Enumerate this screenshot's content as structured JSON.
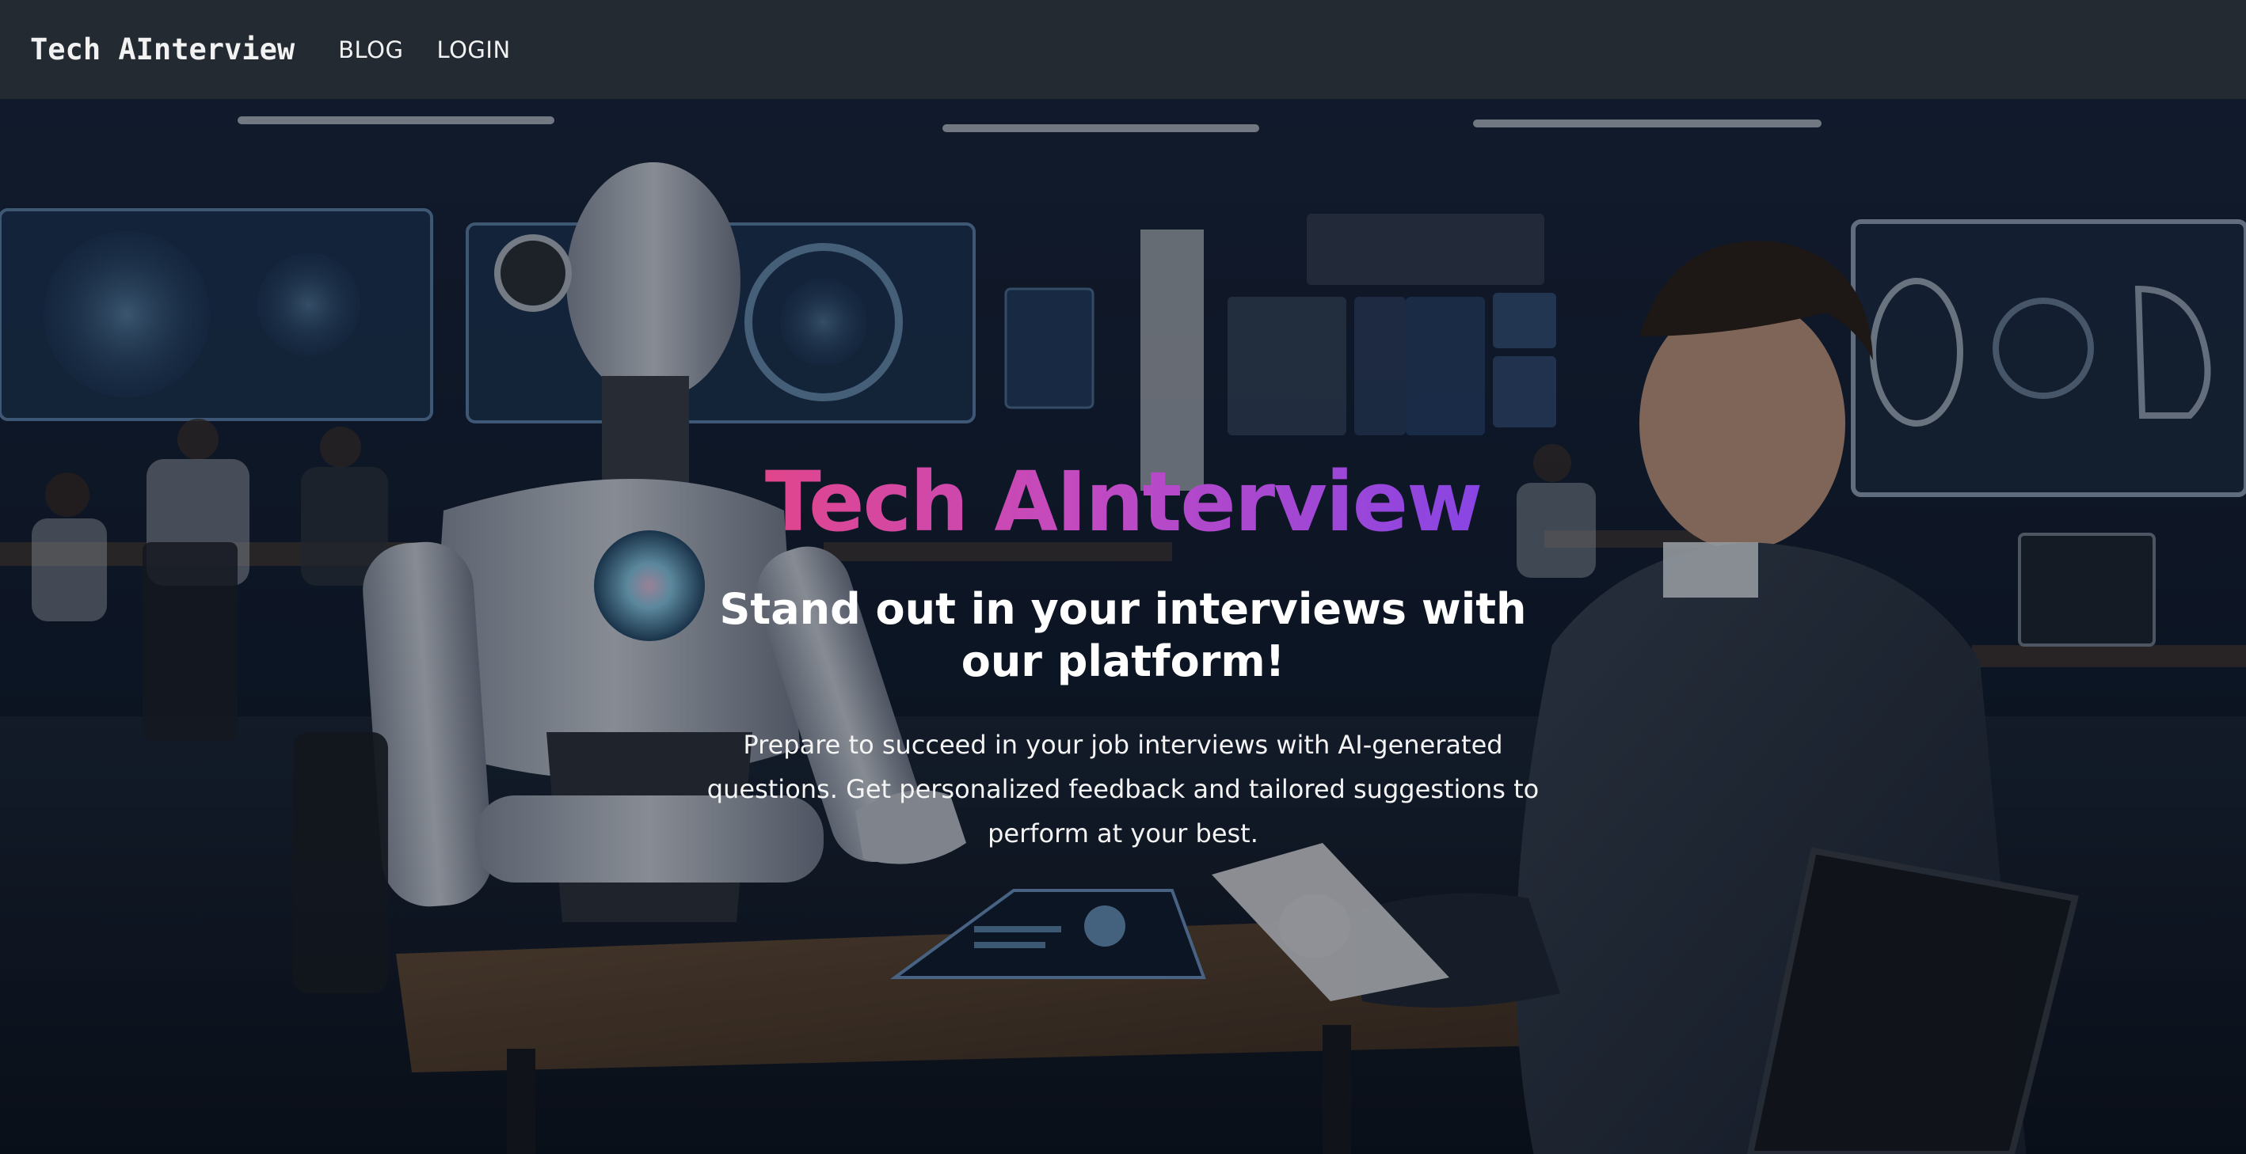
{
  "navbar": {
    "brand": "Tech AInterview",
    "links": [
      {
        "label": "BLOG"
      },
      {
        "label": "LOGIN"
      }
    ]
  },
  "hero": {
    "title": "Tech AInterview",
    "subtitle": "Stand out in your interviews with our platform!",
    "description": "Prepare to succeed in your job interviews with AI-generated questions. Get personalized feedback and tailored suggestions to perform at your best.",
    "title_gradient": [
      "#e8457f",
      "#c24ac1",
      "#7d44ea"
    ]
  },
  "colors": {
    "navbar_bg": "#232a32",
    "nav_text": "#f2f2f2",
    "hero_text": "#ffffff"
  }
}
